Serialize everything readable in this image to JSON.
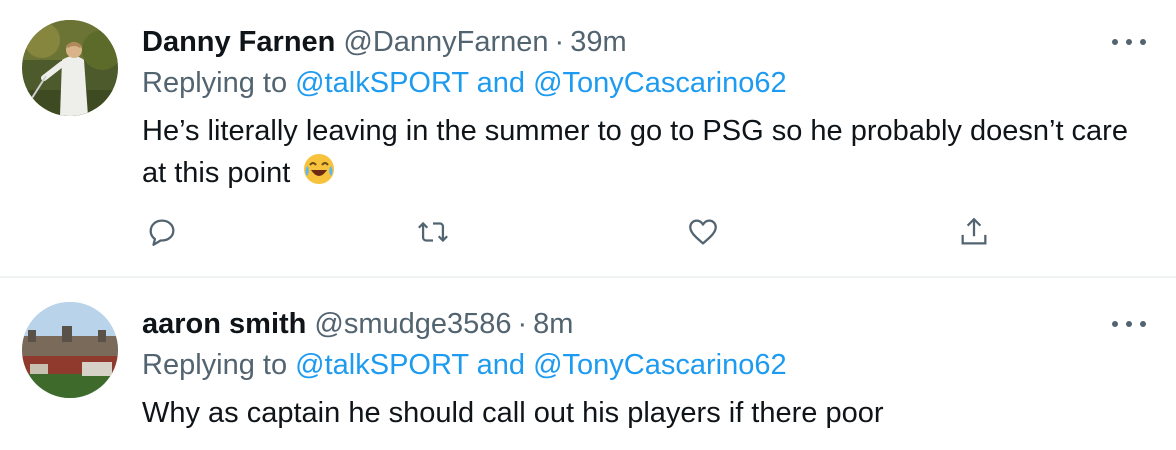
{
  "tweets": [
    {
      "name": "Danny Farnen",
      "handle": "@DannyFarnen",
      "separator": "·",
      "time": "39m",
      "replying_prefix": "Replying to",
      "mention_1": "@talkSPORT",
      "conjunction": "and",
      "mention_2": "@TonyCascarino62",
      "text": "He’s literally leaving in the summer to go to PSG so he probably doesn’t care at this point",
      "emoji": "face-with-tears-of-joy",
      "avatar": "golfer-photo"
    },
    {
      "name": "aaron smith",
      "handle": "@smudge3586",
      "separator": "·",
      "time": "8m",
      "replying_prefix": "Replying to",
      "mention_1": "@talkSPORT",
      "conjunction": "and",
      "mention_2": "@TonyCascarino62",
      "text": "Why as captain he should call out his players if there poor",
      "avatar": "stadium-photo"
    }
  ],
  "actions": [
    "reply-icon",
    "retweet-icon",
    "like-icon",
    "share-icon"
  ],
  "colors": {
    "text": "#0f1419",
    "secondary": "#536471",
    "link": "#1d9bf0",
    "divider": "#eff3f4"
  }
}
